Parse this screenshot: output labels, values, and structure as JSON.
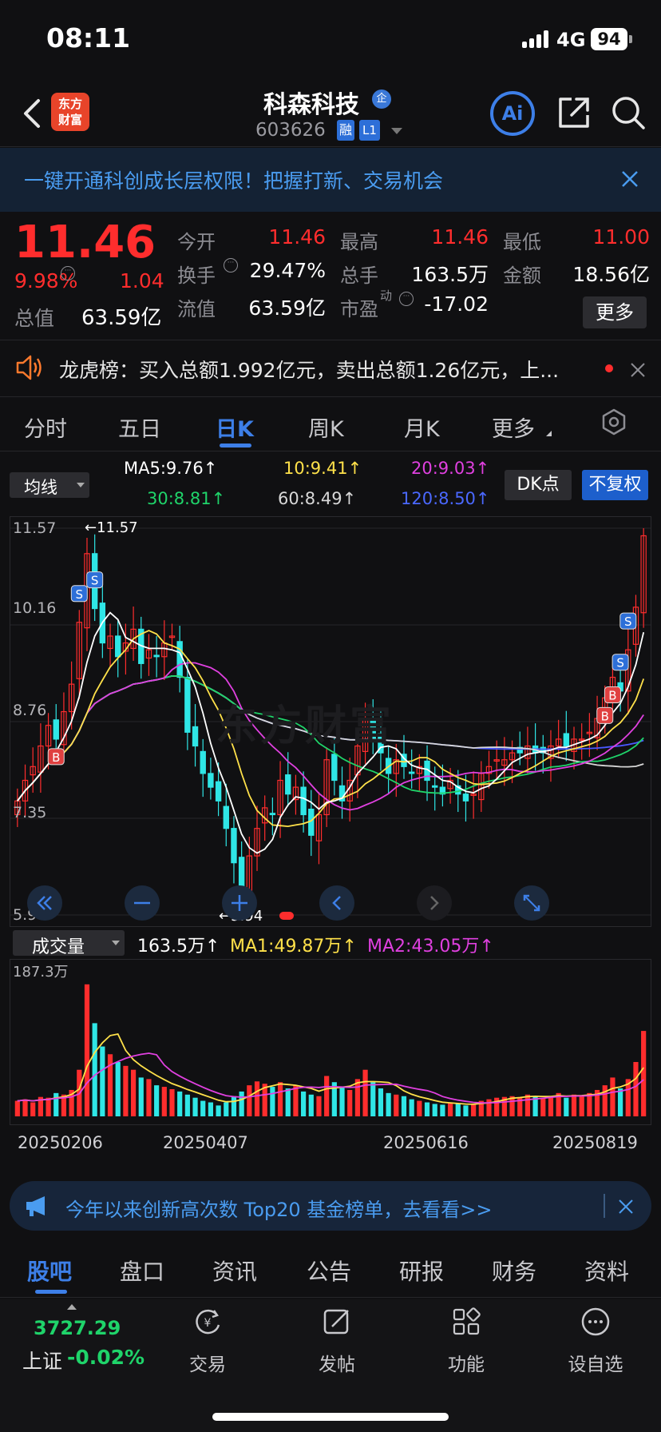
{
  "status": {
    "time": "08:11",
    "network": "4G",
    "battery": "94"
  },
  "header": {
    "logo_text": "东方\n财富",
    "stock_name": "科森科技",
    "qi_badge": "企",
    "stock_code": "603626",
    "rong_badge": "融",
    "level_badge": "L1",
    "ai_label": "Ai"
  },
  "notice": {
    "text": "一键开通科创成长层权限！把握打新、交易机会"
  },
  "quote": {
    "price": "11.46",
    "pct": "9.98%",
    "change": "1.04",
    "mktcap_label": "总值",
    "mktcap_value": "63.59亿",
    "rows": [
      {
        "l1": "今开",
        "v1": "11.46",
        "l2": "最高",
        "v2": "11.46",
        "l3": "最低",
        "v3": "11.00"
      },
      {
        "l1": "换手",
        "v1": "29.47%",
        "l2": "总手",
        "v2": "163.5万",
        "l3": "金额",
        "v3": "18.56亿"
      },
      {
        "l1": "流值",
        "v1": "63.59亿",
        "l2": "市盈",
        "v2": "-17.02",
        "l2sup": "动"
      }
    ],
    "more_label": "更多"
  },
  "lhb": {
    "text": "龙虎榜：买入总额1.992亿元，卖出总额1.26亿元，上..."
  },
  "period_tabs": [
    "分时",
    "五日",
    "日K",
    "周K",
    "月K",
    "更多"
  ],
  "active_period": "日K",
  "ma": {
    "select_label": "均线",
    "ma5": "MA5:9.76",
    "ma10": "10:9.41",
    "ma20": "20:9.03",
    "ma30": "30:8.81",
    "ma60": "60:8.49",
    "ma120": "120:8.50",
    "dk_label": "DK点",
    "fq_label": "不复权",
    "arrow": "↑"
  },
  "chart_data": {
    "type": "candlestick",
    "y_axis_labels": [
      "11.57",
      "10.16",
      "8.76",
      "7.35",
      "5.94"
    ],
    "ylim": [
      5.94,
      11.57
    ],
    "high_marker": "←11.57",
    "low_marker": "←5.94",
    "watermark": "东方财富",
    "marker_labels": {
      "sell": "S",
      "buy": "B"
    },
    "colors": {
      "up": "#ff2d2d",
      "down": "#2fe6e6",
      "ma5": "#ffffff",
      "ma10": "#ffe14a",
      "ma20": "#e040e0",
      "ma30": "#1fd46a",
      "ma60": "#d8d8d8",
      "ma120": "#4a58ff"
    },
    "closes": [
      7.6,
      7.9,
      8.1,
      8.4,
      8.7,
      8.5,
      8.9,
      9.3,
      10.2,
      11.2,
      10.4,
      9.9,
      10.0,
      9.7,
      9.9,
      10.1,
      9.6,
      9.8,
      9.7,
      9.9,
      10.0,
      9.4,
      8.6,
      8.4,
      8.0,
      7.8,
      7.6,
      7.2,
      6.7,
      6.3,
      6.8,
      7.2,
      7.5,
      7.4,
      7.9,
      7.7,
      7.8,
      7.4,
      7.1,
      7.4,
      8.2,
      7.9,
      7.6,
      7.9,
      8.4,
      8.8,
      8.5,
      8.3,
      8.0,
      8.2,
      8.1,
      8.0,
      8.1,
      7.9,
      7.8,
      7.7,
      7.9,
      7.7,
      7.6,
      7.7,
      8.0,
      8.1,
      8.2,
      8.2,
      8.3,
      8.3,
      8.4,
      8.3,
      8.3,
      8.4,
      8.5,
      8.4,
      8.5,
      8.5,
      8.6,
      8.8,
      9.1,
      9.4,
      9.2,
      9.8,
      10.42,
      11.46
    ],
    "x_date_labels": [
      "20250206",
      "20250407",
      "20250616",
      "20250819"
    ]
  },
  "volume": {
    "select_label": "成交量",
    "value": "163.5万",
    "ma1": "MA1:49.87万",
    "ma2": "MA2:43.05万",
    "max_label": "187.3万",
    "arrow": "↑",
    "bars": [
      20,
      22,
      18,
      25,
      24,
      30,
      28,
      34,
      60,
      170,
      120,
      90,
      80,
      70,
      65,
      60,
      50,
      48,
      40,
      38,
      35,
      32,
      28,
      24,
      20,
      18,
      14,
      18,
      26,
      32,
      40,
      45,
      42,
      38,
      44,
      36,
      40,
      32,
      28,
      26,
      52,
      44,
      38,
      34,
      48,
      60,
      44,
      36,
      30,
      28,
      26,
      22,
      20,
      18,
      16,
      15,
      18,
      16,
      14,
      15,
      20,
      22,
      24,
      25,
      26,
      24,
      28,
      26,
      24,
      26,
      30,
      24,
      28,
      26,
      30,
      34,
      40,
      50,
      36,
      48,
      70,
      110
    ]
  },
  "ad": {
    "text": "今年以来创新高次数 Top20 基金榜单，去看看>>"
  },
  "content_tabs": [
    "股吧",
    "盘口",
    "资讯",
    "公告",
    "研报",
    "财务",
    "资料"
  ],
  "bottom": {
    "index_value": "3727.29",
    "index_name": "上证",
    "index_pct": "-0.02%",
    "items": [
      {
        "name": "trade",
        "label": "交易"
      },
      {
        "name": "post",
        "label": "发帖"
      },
      {
        "name": "functions",
        "label": "功能"
      },
      {
        "name": "add-watchlist",
        "label": "设自选"
      }
    ]
  }
}
